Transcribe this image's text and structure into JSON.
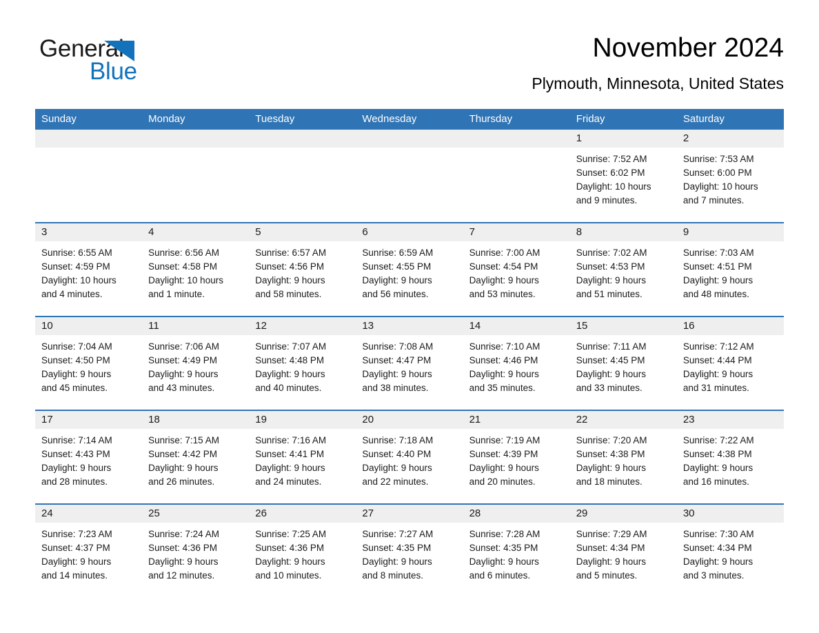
{
  "logo": {
    "text_primary": "General",
    "text_secondary": "Blue",
    "primary_color": "#1a1a1a",
    "accent_color": "#1272bc",
    "icon": "triangle-icon"
  },
  "header": {
    "title": "November 2024",
    "subtitle": "Plymouth, Minnesota, United States"
  },
  "theme": {
    "header_bar_color": "#2f74b5",
    "day_band_color": "#efefef",
    "row_divider_color": "#2f74b5",
    "text_color": "#1a1a1a",
    "background": "#ffffff"
  },
  "calendar": {
    "weekdays": [
      "Sunday",
      "Monday",
      "Tuesday",
      "Wednesday",
      "Thursday",
      "Friday",
      "Saturday"
    ],
    "weeks": [
      [
        {
          "day": "",
          "lines": []
        },
        {
          "day": "",
          "lines": []
        },
        {
          "day": "",
          "lines": []
        },
        {
          "day": "",
          "lines": []
        },
        {
          "day": "",
          "lines": []
        },
        {
          "day": "1",
          "lines": [
            "Sunrise: 7:52 AM",
            "Sunset: 6:02 PM",
            "Daylight: 10 hours",
            "and 9 minutes."
          ]
        },
        {
          "day": "2",
          "lines": [
            "Sunrise: 7:53 AM",
            "Sunset: 6:00 PM",
            "Daylight: 10 hours",
            "and 7 minutes."
          ]
        }
      ],
      [
        {
          "day": "3",
          "lines": [
            "Sunrise: 6:55 AM",
            "Sunset: 4:59 PM",
            "Daylight: 10 hours",
            "and 4 minutes."
          ]
        },
        {
          "day": "4",
          "lines": [
            "Sunrise: 6:56 AM",
            "Sunset: 4:58 PM",
            "Daylight: 10 hours",
            "and 1 minute."
          ]
        },
        {
          "day": "5",
          "lines": [
            "Sunrise: 6:57 AM",
            "Sunset: 4:56 PM",
            "Daylight: 9 hours",
            "and 58 minutes."
          ]
        },
        {
          "day": "6",
          "lines": [
            "Sunrise: 6:59 AM",
            "Sunset: 4:55 PM",
            "Daylight: 9 hours",
            "and 56 minutes."
          ]
        },
        {
          "day": "7",
          "lines": [
            "Sunrise: 7:00 AM",
            "Sunset: 4:54 PM",
            "Daylight: 9 hours",
            "and 53 minutes."
          ]
        },
        {
          "day": "8",
          "lines": [
            "Sunrise: 7:02 AM",
            "Sunset: 4:53 PM",
            "Daylight: 9 hours",
            "and 51 minutes."
          ]
        },
        {
          "day": "9",
          "lines": [
            "Sunrise: 7:03 AM",
            "Sunset: 4:51 PM",
            "Daylight: 9 hours",
            "and 48 minutes."
          ]
        }
      ],
      [
        {
          "day": "10",
          "lines": [
            "Sunrise: 7:04 AM",
            "Sunset: 4:50 PM",
            "Daylight: 9 hours",
            "and 45 minutes."
          ]
        },
        {
          "day": "11",
          "lines": [
            "Sunrise: 7:06 AM",
            "Sunset: 4:49 PM",
            "Daylight: 9 hours",
            "and 43 minutes."
          ]
        },
        {
          "day": "12",
          "lines": [
            "Sunrise: 7:07 AM",
            "Sunset: 4:48 PM",
            "Daylight: 9 hours",
            "and 40 minutes."
          ]
        },
        {
          "day": "13",
          "lines": [
            "Sunrise: 7:08 AM",
            "Sunset: 4:47 PM",
            "Daylight: 9 hours",
            "and 38 minutes."
          ]
        },
        {
          "day": "14",
          "lines": [
            "Sunrise: 7:10 AM",
            "Sunset: 4:46 PM",
            "Daylight: 9 hours",
            "and 35 minutes."
          ]
        },
        {
          "day": "15",
          "lines": [
            "Sunrise: 7:11 AM",
            "Sunset: 4:45 PM",
            "Daylight: 9 hours",
            "and 33 minutes."
          ]
        },
        {
          "day": "16",
          "lines": [
            "Sunrise: 7:12 AM",
            "Sunset: 4:44 PM",
            "Daylight: 9 hours",
            "and 31 minutes."
          ]
        }
      ],
      [
        {
          "day": "17",
          "lines": [
            "Sunrise: 7:14 AM",
            "Sunset: 4:43 PM",
            "Daylight: 9 hours",
            "and 28 minutes."
          ]
        },
        {
          "day": "18",
          "lines": [
            "Sunrise: 7:15 AM",
            "Sunset: 4:42 PM",
            "Daylight: 9 hours",
            "and 26 minutes."
          ]
        },
        {
          "day": "19",
          "lines": [
            "Sunrise: 7:16 AM",
            "Sunset: 4:41 PM",
            "Daylight: 9 hours",
            "and 24 minutes."
          ]
        },
        {
          "day": "20",
          "lines": [
            "Sunrise: 7:18 AM",
            "Sunset: 4:40 PM",
            "Daylight: 9 hours",
            "and 22 minutes."
          ]
        },
        {
          "day": "21",
          "lines": [
            "Sunrise: 7:19 AM",
            "Sunset: 4:39 PM",
            "Daylight: 9 hours",
            "and 20 minutes."
          ]
        },
        {
          "day": "22",
          "lines": [
            "Sunrise: 7:20 AM",
            "Sunset: 4:38 PM",
            "Daylight: 9 hours",
            "and 18 minutes."
          ]
        },
        {
          "day": "23",
          "lines": [
            "Sunrise: 7:22 AM",
            "Sunset: 4:38 PM",
            "Daylight: 9 hours",
            "and 16 minutes."
          ]
        }
      ],
      [
        {
          "day": "24",
          "lines": [
            "Sunrise: 7:23 AM",
            "Sunset: 4:37 PM",
            "Daylight: 9 hours",
            "and 14 minutes."
          ]
        },
        {
          "day": "25",
          "lines": [
            "Sunrise: 7:24 AM",
            "Sunset: 4:36 PM",
            "Daylight: 9 hours",
            "and 12 minutes."
          ]
        },
        {
          "day": "26",
          "lines": [
            "Sunrise: 7:25 AM",
            "Sunset: 4:36 PM",
            "Daylight: 9 hours",
            "and 10 minutes."
          ]
        },
        {
          "day": "27",
          "lines": [
            "Sunrise: 7:27 AM",
            "Sunset: 4:35 PM",
            "Daylight: 9 hours",
            "and 8 minutes."
          ]
        },
        {
          "day": "28",
          "lines": [
            "Sunrise: 7:28 AM",
            "Sunset: 4:35 PM",
            "Daylight: 9 hours",
            "and 6 minutes."
          ]
        },
        {
          "day": "29",
          "lines": [
            "Sunrise: 7:29 AM",
            "Sunset: 4:34 PM",
            "Daylight: 9 hours",
            "and 5 minutes."
          ]
        },
        {
          "day": "30",
          "lines": [
            "Sunrise: 7:30 AM",
            "Sunset: 4:34 PM",
            "Daylight: 9 hours",
            "and 3 minutes."
          ]
        }
      ]
    ]
  }
}
